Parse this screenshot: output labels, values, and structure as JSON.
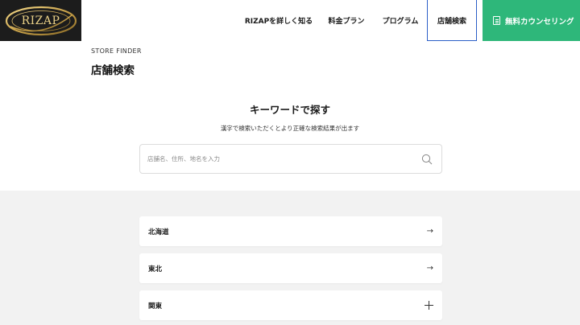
{
  "header": {
    "logo_text": "RIZAP",
    "nav": [
      {
        "label": "RIZAPを詳しく知る"
      },
      {
        "label": "料金プラン"
      },
      {
        "label": "プログラム"
      },
      {
        "label": "店舗検索",
        "active": true
      }
    ],
    "cta_label": "無料カウンセリング",
    "cta_icon": "document-icon",
    "active_color": "#2b5fc7",
    "cta_color": "#2eb77a"
  },
  "page": {
    "eyebrow": "STORE FINDER",
    "title": "店舗検索"
  },
  "keyword": {
    "title": "キーワードで探す",
    "subtitle": "漢字で検索いただくとより正確な検索結果が出ます",
    "placeholder": "店舗名、住所、地名を入力",
    "value": "",
    "icon": "search-icon"
  },
  "regions": [
    {
      "label": "北海道",
      "icon": "arrow-right-icon",
      "glyph": "→"
    },
    {
      "label": "東北",
      "icon": "arrow-right-icon",
      "glyph": "→"
    },
    {
      "label": "関東",
      "icon": "plus-icon"
    }
  ]
}
